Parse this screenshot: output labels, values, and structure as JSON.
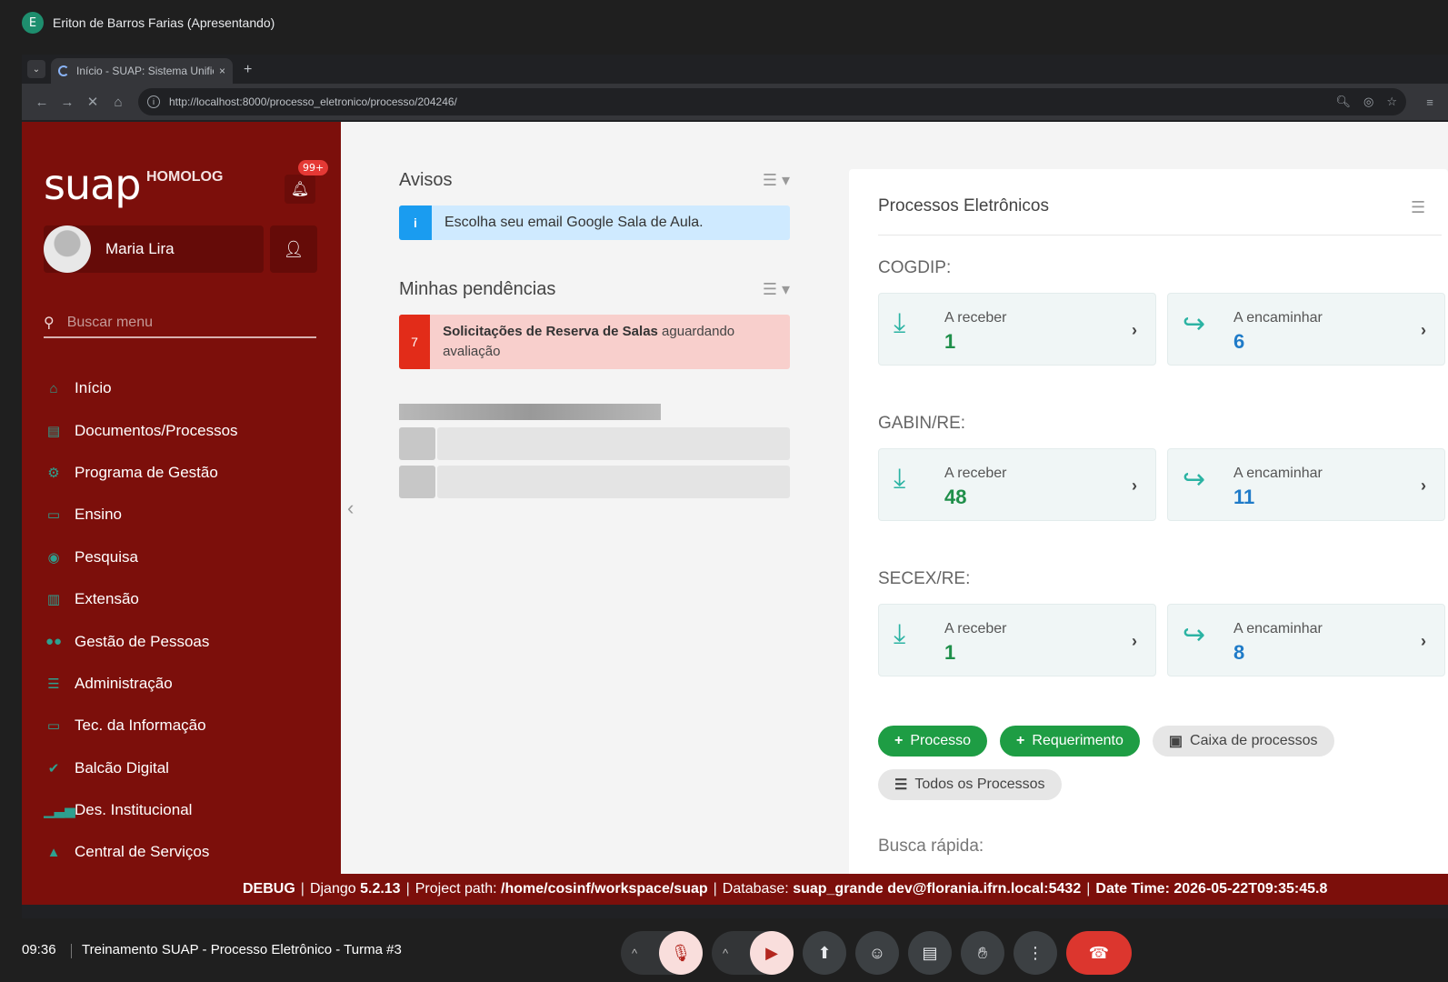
{
  "presenter": {
    "initial": "E",
    "label": "Eriton de Barros Farias (Apresentando)"
  },
  "browser": {
    "tab_title": "Início - SUAP: Sistema Unificado",
    "tab_close": "×",
    "new_tab": "+",
    "url": "http://localhost:8000/processo_eletronico/processo/204246/"
  },
  "sidebar": {
    "logo": "suap",
    "env": "HOMOLOG",
    "notif_count": "99+",
    "user_name": "Maria Lira",
    "search_placeholder": "Buscar menu",
    "items": [
      {
        "label": "Início",
        "icon": "home-icon"
      },
      {
        "label": "Documentos/Processos",
        "icon": "documents-icon"
      },
      {
        "label": "Programa de Gestão",
        "icon": "management-icon"
      },
      {
        "label": "Ensino",
        "icon": "teaching-icon"
      },
      {
        "label": "Pesquisa",
        "icon": "globe-icon"
      },
      {
        "label": "Extensão",
        "icon": "building-icon"
      },
      {
        "label": "Gestão de Pessoas",
        "icon": "people-icon"
      },
      {
        "label": "Administração",
        "icon": "list-icon"
      },
      {
        "label": "Tec. da Informação",
        "icon": "laptop-icon"
      },
      {
        "label": "Balcão Digital",
        "icon": "check-icon"
      },
      {
        "label": "Des. Institucional",
        "icon": "bar-chart-icon"
      },
      {
        "label": "Central de Serviços",
        "icon": "service-icon"
      }
    ]
  },
  "avisos": {
    "title": "Avisos",
    "message": "Escolha seu email Google Sala de Aula."
  },
  "pendencias": {
    "title": "Minhas pendências",
    "count": "7",
    "bold": "Solicitações de Reserva de Salas",
    "rest": " aguardando avaliação"
  },
  "processos": {
    "title": "Processos Eletrônicos",
    "groups": [
      {
        "name": "COGDIP:",
        "receber_label": "A receber",
        "receber": "1",
        "encaminhar_label": "A encaminhar",
        "encaminhar": "6"
      },
      {
        "name": "GABIN/RE:",
        "receber_label": "A receber",
        "receber": "48",
        "encaminhar_label": "A encaminhar",
        "encaminhar": "11"
      },
      {
        "name": "SECEX/RE:",
        "receber_label": "A receber",
        "receber": "1",
        "encaminhar_label": "A encaminhar",
        "encaminhar": "8"
      }
    ],
    "btn_processo": "Processo",
    "btn_requerimento": "Requerimento",
    "btn_caixa": "Caixa de processos",
    "btn_todos": "Todos os Processos",
    "busca": "Busca rápida:"
  },
  "debug": {
    "debug": "DEBUG",
    "django_label": "Django",
    "django_version": "5.2.13",
    "path_label": "Project path:",
    "path": "/home/cosinf/workspace/suap",
    "db_label": "Database:",
    "db": "suap_grande dev@florania.ifrn.local:5432",
    "dt_label": "Date Time:",
    "dt": "2026-05-22T09:35:45.8"
  },
  "meet": {
    "time": "09:36",
    "title": "Treinamento SUAP - Processo Eletrônico - Turma #3"
  },
  "colors": {
    "suap_red": "#7c0f0b",
    "green": "#1e9d44",
    "teal": "#2bb3a3",
    "info_blue": "#1a9cf0"
  }
}
